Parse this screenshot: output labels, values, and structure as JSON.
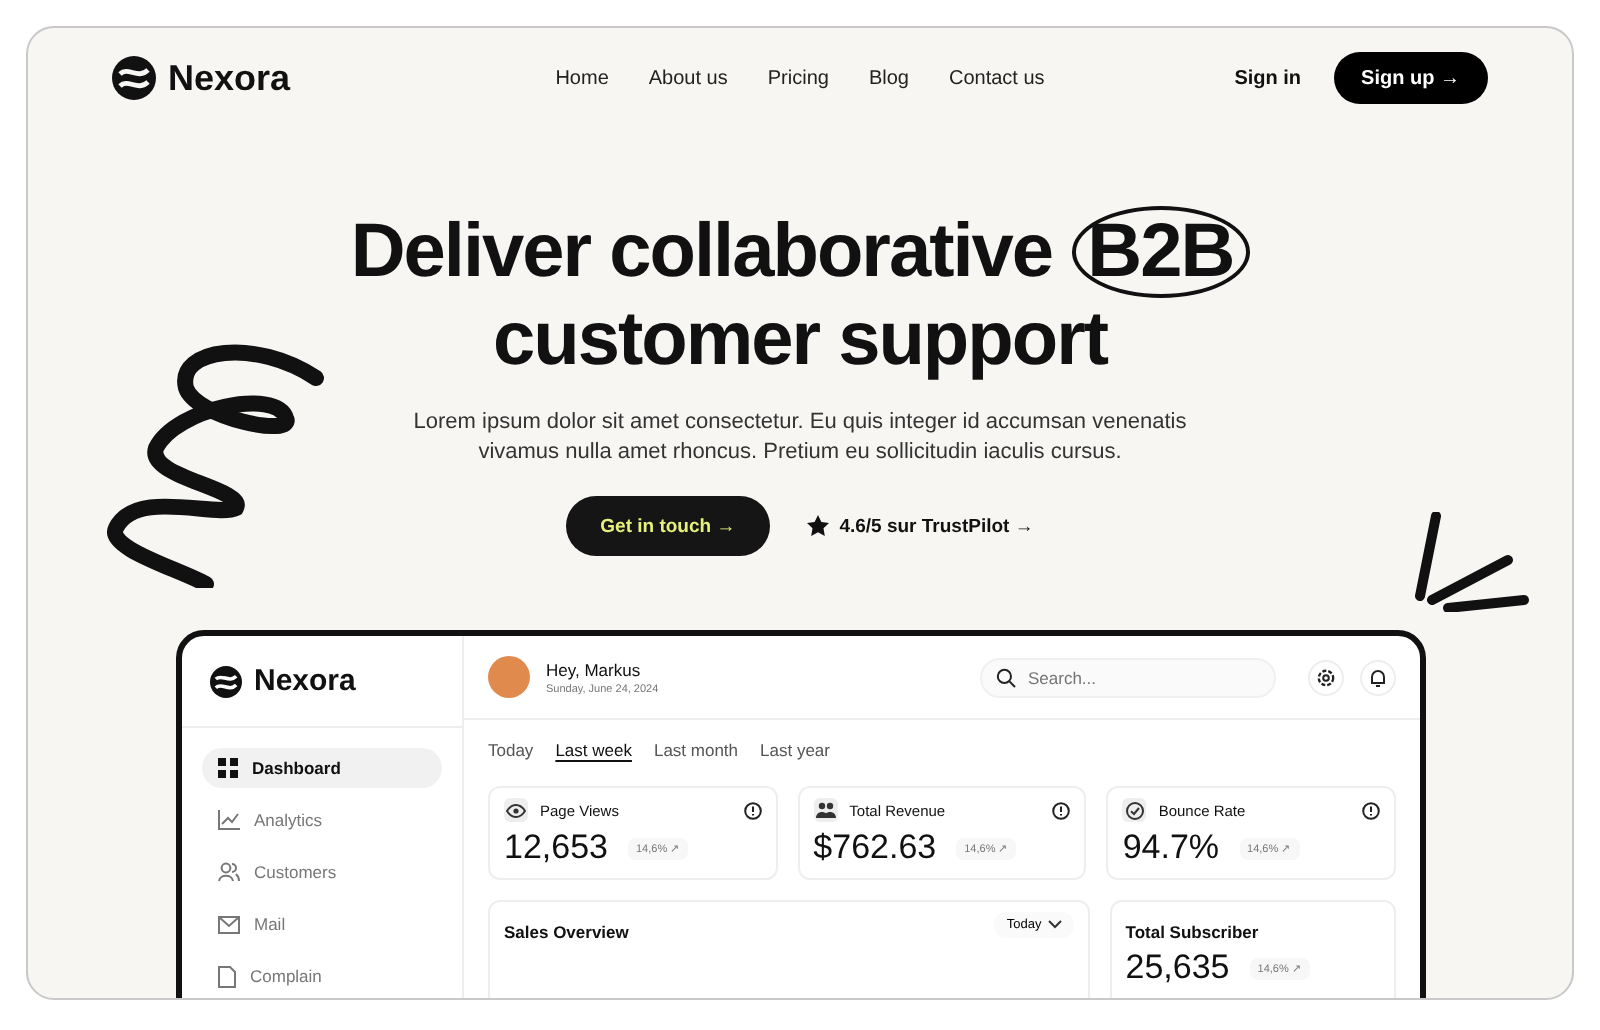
{
  "brand": "Nexora",
  "nav": [
    {
      "label": "Home"
    },
    {
      "label": "About us"
    },
    {
      "label": "Pricing"
    },
    {
      "label": "Blog"
    },
    {
      "label": "Contact us"
    }
  ],
  "sign_in": "Sign in",
  "sign_up": "Sign up →",
  "hero": {
    "title_1": "Deliver collaborative",
    "title_circled": "B2B",
    "title_2": "customer support",
    "text": "Lorem ipsum dolor sit amet consectetur. Eu quis integer id accumsan venenatis vivamus nulla amet rhoncus. Pretium eu sollicitudin iaculis cursus.",
    "cta": "Get in touch →",
    "rating": "4.6/5 sur TrustPilot →"
  },
  "dashboard": {
    "brand": "Nexora",
    "greeting": "Hey, Markus",
    "date": "Sunday, June 24, 2024",
    "search": {
      "placeholder": "Search..."
    },
    "sidebar": [
      {
        "label": "Dashboard",
        "kind": "grid",
        "selected": true
      },
      {
        "label": "Analytics",
        "kind": "chart",
        "selected": false
      },
      {
        "label": "Customers",
        "kind": "users",
        "selected": false
      },
      {
        "label": "Mail",
        "kind": "mail",
        "selected": false
      },
      {
        "label": "Complain",
        "kind": "doc",
        "selected": false
      }
    ],
    "periods": [
      {
        "label": "Today",
        "selected": false
      },
      {
        "label": "Last week",
        "selected": true
      },
      {
        "label": "Last month",
        "selected": false
      },
      {
        "label": "Last year",
        "selected": false
      }
    ],
    "stats": [
      {
        "title": "Page Views",
        "kind": "eye",
        "value": "12,653",
        "change": "14,6% ↗"
      },
      {
        "title": "Total Revenue",
        "kind": "users",
        "value": "$762.63",
        "change": "14,6% ↗"
      },
      {
        "title": "Bounce Rate",
        "kind": "check",
        "value": "94.7%",
        "change": "14,6% ↗"
      }
    ],
    "sales": {
      "title": "Sales Overview",
      "range": "Today"
    },
    "subscriber": {
      "title": "Total Subscriber",
      "value": "25,635",
      "change": "14,6% ↗"
    }
  }
}
